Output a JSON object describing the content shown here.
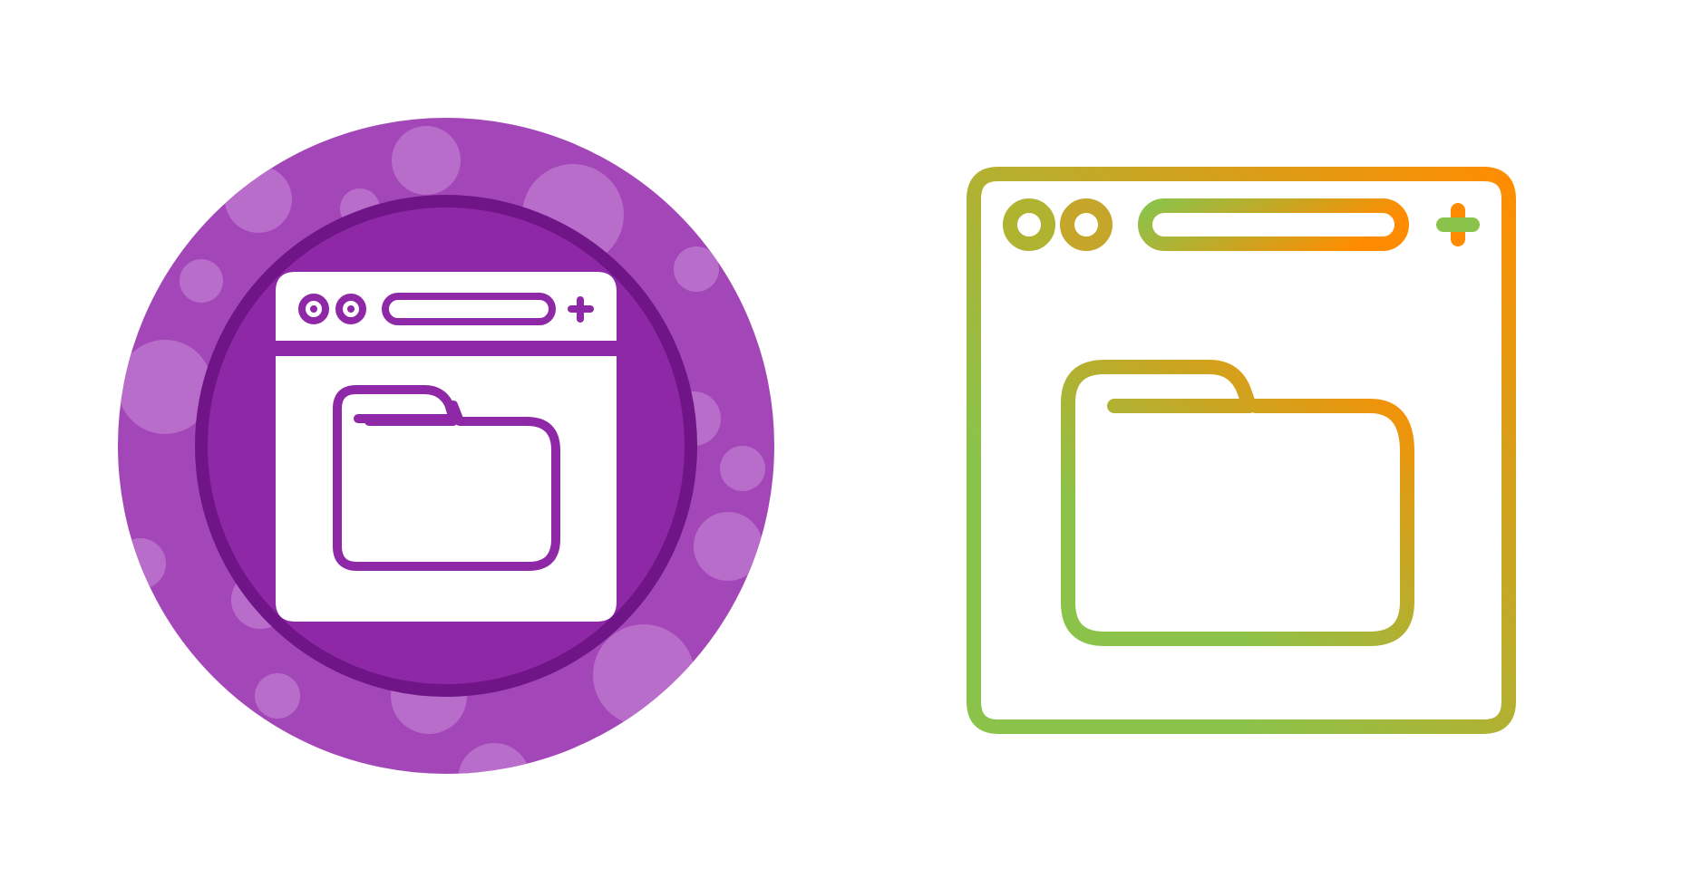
{
  "icons": [
    {
      "name": "browser-folder-icon-filled",
      "style": "filled-badge",
      "colors": {
        "badge_outer": "#a347b8",
        "badge_inner": "#8e28a6",
        "ring": "#6f1588",
        "bubble": "#c07ad0",
        "glyph": "#ffffff"
      }
    },
    {
      "name": "browser-folder-icon-outline",
      "style": "gradient-outline",
      "colors": {
        "gradient_start": "#8bc34a",
        "gradient_end": "#ff8c00"
      }
    }
  ]
}
